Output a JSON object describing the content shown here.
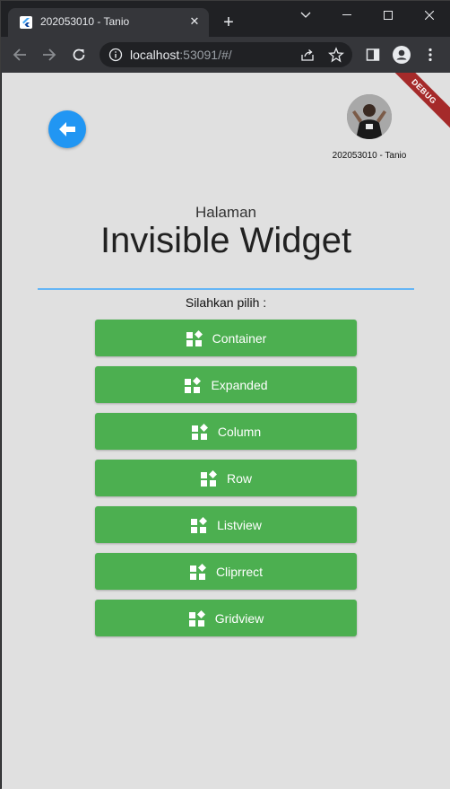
{
  "browser": {
    "tab_title": "202053010 - Tanio",
    "url_host": "localhost",
    "url_rest": ":53091/#/"
  },
  "page": {
    "debug_banner": "DEBUG",
    "avatar_caption": "202053010 - Tanio",
    "subtitle": "Halaman",
    "title": "Invisible Widget",
    "prompt": "Silahkan pilih :",
    "buttons": [
      {
        "label": "Container"
      },
      {
        "label": "Expanded"
      },
      {
        "label": "Column"
      },
      {
        "label": "Row"
      },
      {
        "label": "Listview"
      },
      {
        "label": "Cliprrect"
      },
      {
        "label": "Gridview"
      }
    ]
  },
  "colors": {
    "accent_blue": "#2196f3",
    "button_green": "#4caf50",
    "divider_blue": "#64b5f6",
    "page_bg": "#e0e0e0"
  }
}
